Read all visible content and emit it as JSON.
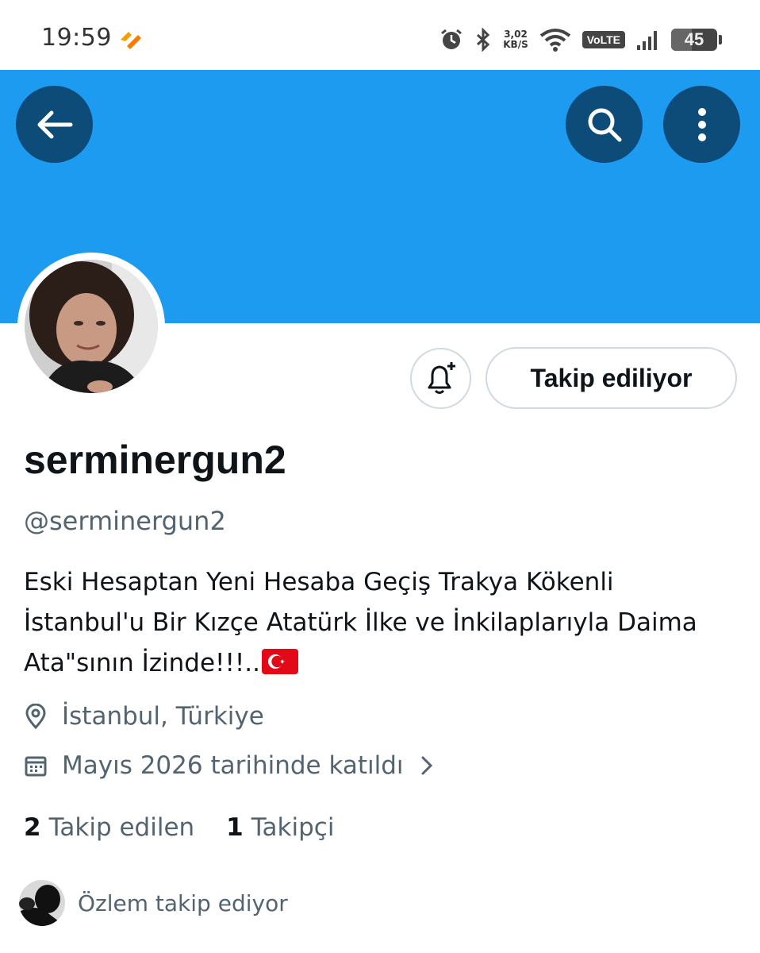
{
  "status_bar": {
    "time": "19:59",
    "net_speed_value": "3,02",
    "net_speed_unit": "KB/S",
    "network_label": "VoLTE",
    "battery_level": "45",
    "battery_fraction": 0.45,
    "icons": [
      "app-notification-icon",
      "alarm-icon",
      "bluetooth-icon",
      "wifi-icon",
      "signal-icon",
      "battery-icon"
    ]
  },
  "header": {
    "banner_color": "#1d9bf0",
    "button_color": "#0d4b78",
    "back_icon": "arrow-left-icon",
    "search_icon": "search-icon",
    "more_icon": "more-vertical-icon"
  },
  "profile": {
    "display_name": "serminergun2",
    "handle": "@serminergun2",
    "bio_line1": "Eski Hesaptan Yeni Hesaba Geçiş Trakya Kökenli",
    "bio_line2": "İstanbul'u Bir Kızçe Atatürk İlke ve İnkilaplarıyla Daima",
    "bio_line3": "Ata\"sının İzinde!!!..",
    "bio_flag": "turkey-flag",
    "location": "İstanbul, Türkiye",
    "joined": "Mayıs 2026 tarihinde katıldı",
    "notify_icon": "bell-plus-icon",
    "follow_button_label": "Takip ediliyor"
  },
  "stats": {
    "following_count": "2",
    "following_label": "Takip edilen",
    "followers_count": "1",
    "followers_label": "Takipçi"
  },
  "followed_by": {
    "text": "Özlem takip ediyor"
  }
}
